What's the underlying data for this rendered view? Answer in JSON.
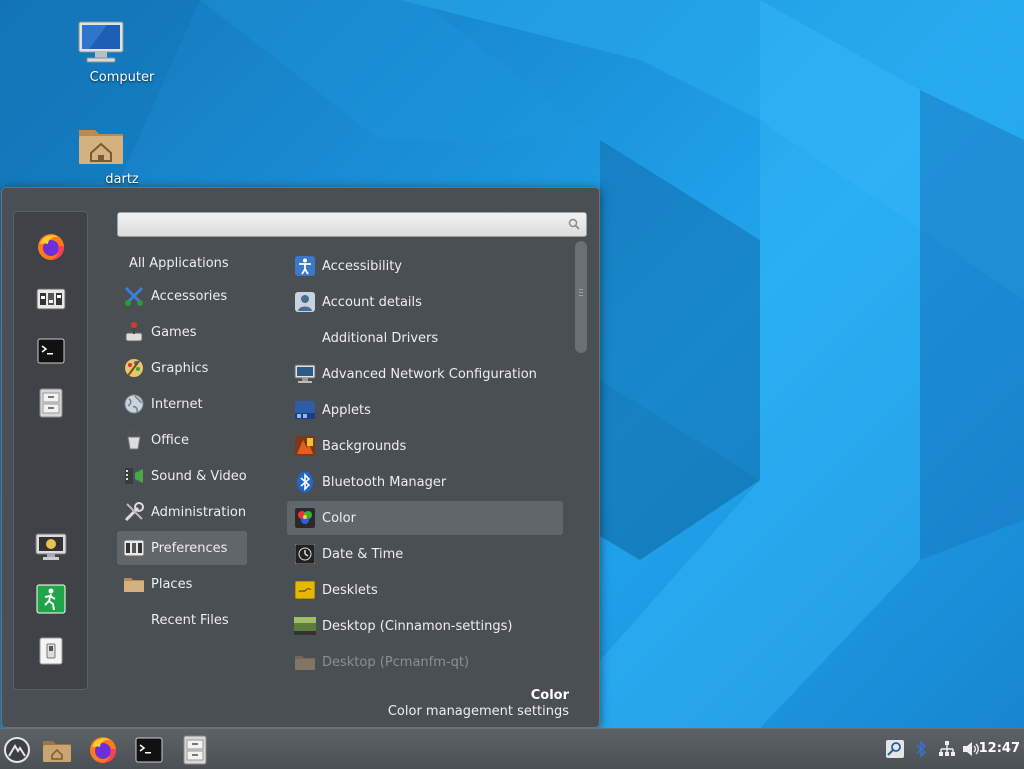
{
  "desktop": {
    "icons": [
      {
        "name": "computer",
        "label": "Computer"
      },
      {
        "name": "home",
        "label": "dartz"
      }
    ]
  },
  "menu": {
    "search": {
      "value": "",
      "placeholder": ""
    },
    "favorites": [
      "firefox-icon",
      "settings-icon",
      "terminal-icon",
      "files-icon"
    ],
    "session": [
      "lock-screen-icon",
      "logout-icon",
      "shutdown-icon"
    ],
    "categories": [
      {
        "label": "All Applications",
        "icon": ""
      },
      {
        "label": "Accessories",
        "icon": "accessories-icon"
      },
      {
        "label": "Games",
        "icon": "games-icon"
      },
      {
        "label": "Graphics",
        "icon": "graphics-icon"
      },
      {
        "label": "Internet",
        "icon": "internet-icon"
      },
      {
        "label": "Office",
        "icon": "office-icon"
      },
      {
        "label": "Sound & Video",
        "icon": "sound-video-icon"
      },
      {
        "label": "Administration",
        "icon": "administration-icon"
      },
      {
        "label": "Preferences",
        "icon": "preferences-icon"
      },
      {
        "label": "Places",
        "icon": "places-icon"
      },
      {
        "label": "Recent Files",
        "icon": ""
      }
    ],
    "selected_category": "Preferences",
    "apps": [
      {
        "label": "Accessibility",
        "icon": "accessibility-icon"
      },
      {
        "label": "Account details",
        "icon": "account-icon"
      },
      {
        "label": "Additional Drivers",
        "icon": ""
      },
      {
        "label": "Advanced Network Configuration",
        "icon": "network-config-icon"
      },
      {
        "label": "Applets",
        "icon": "applets-icon"
      },
      {
        "label": "Backgrounds",
        "icon": "backgrounds-icon"
      },
      {
        "label": "Bluetooth Manager",
        "icon": "bluetooth-icon"
      },
      {
        "label": "Color",
        "icon": "color-icon"
      },
      {
        "label": "Date & Time",
        "icon": "date-time-icon"
      },
      {
        "label": "Desklets",
        "icon": "desklets-icon"
      },
      {
        "label": "Desktop (Cinnamon-settings)",
        "icon": "desktop-icon"
      },
      {
        "label": "Desktop (Pcmanfm-qt)",
        "icon": "desktop-qt-icon"
      }
    ],
    "selected_app": "Color",
    "info": {
      "title": "Color",
      "description": "Color management settings"
    }
  },
  "panel": {
    "launchers": [
      "menu-icon",
      "files-icon",
      "firefox-icon",
      "terminal-icon",
      "file-cabinet-icon"
    ],
    "tray": [
      "search-tool-icon",
      "bluetooth-tray-icon",
      "network-icon",
      "volume-icon"
    ],
    "clock": "12:47"
  },
  "colors": {
    "menu_bg": "#4a4f54",
    "selection": "#61666b",
    "desktop_blue": "#1a90d8"
  }
}
